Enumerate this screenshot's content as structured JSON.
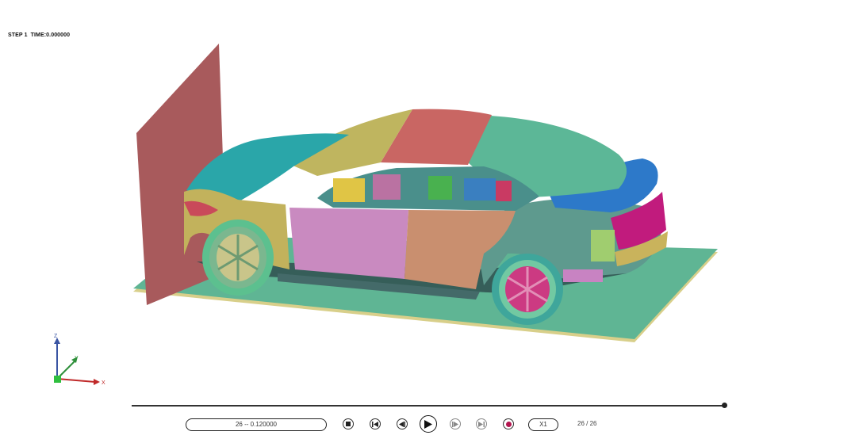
{
  "header": {
    "step_label": "STEP 1",
    "time_label": "TIME:0.000000"
  },
  "scene": {
    "model": "car-crash-model",
    "colors": {
      "barrier_wall": "#a85a5c",
      "ground_plane": "#5fb594",
      "ground_edge": "#d8cf8a",
      "hood": "#2aa6a9",
      "front_fender": "#c2b25c",
      "roof_front": "#bfb55f",
      "roof_mid": "#c96663",
      "roof_rear": "#5cb797",
      "trunk": "#2d79c9",
      "front_door": "#c98ac0",
      "rear_door": "#c98f6f",
      "quarter_panel": "#5e9a8e",
      "rear_bumper": "#c11b7d",
      "wheel_rim": "#7bb78f",
      "rear_rim": "#cc3a82",
      "tire": "#3fa69b",
      "sill": "#446a69"
    }
  },
  "axes": {
    "z": "Z",
    "y": "Y",
    "x": "X"
  },
  "playback": {
    "frame_range": "26 -- 0.120000",
    "speed": "X1",
    "frame_counter": "26 / 26",
    "progress": 1.0
  },
  "icons": {
    "stop": "stop-icon",
    "first": "skip-first-icon",
    "prev": "step-back-icon",
    "play": "play-icon",
    "next": "step-forward-icon",
    "last": "skip-last-icon",
    "record": "record-icon"
  }
}
